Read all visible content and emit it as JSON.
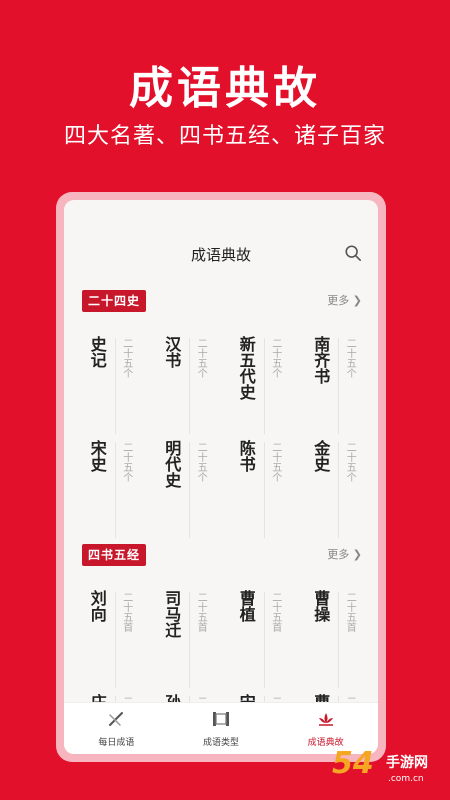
{
  "hero": {
    "title": "成语典故",
    "subtitle": "四大名著、四书五经、诸子百家"
  },
  "app": {
    "title": "成语典故",
    "search_icon": "search-icon"
  },
  "sections": [
    {
      "badge": "二十四史",
      "more": "更多 ❯",
      "items": [
        {
          "name": "史记",
          "count": "二十五个"
        },
        {
          "name": "汉书",
          "count": "二十五个"
        },
        {
          "name": "新五代史",
          "count": "二十五个"
        },
        {
          "name": "南齐书",
          "count": "二十五个"
        },
        {
          "name": "宋史",
          "count": "二十五个"
        },
        {
          "name": "明代史",
          "count": "二十五个"
        },
        {
          "name": "陈书",
          "count": "二十五个"
        },
        {
          "name": "金史",
          "count": "二十五个"
        }
      ]
    },
    {
      "badge": "四书五经",
      "more": "更多 ❯",
      "items": [
        {
          "name": "刘向",
          "count": "二十五首"
        },
        {
          "name": "司马迁",
          "count": "二十五首"
        },
        {
          "name": "曹植",
          "count": "二十五首"
        },
        {
          "name": "曹操",
          "count": "二十五首"
        },
        {
          "name": "庄",
          "count": "二"
        },
        {
          "name": "孙",
          "count": "二"
        },
        {
          "name": "宋",
          "count": "二"
        },
        {
          "name": "曹",
          "count": "二"
        }
      ]
    }
  ],
  "tabs": [
    {
      "label": "每日成语",
      "icon": "pen-brush-icon"
    },
    {
      "label": "成语类型",
      "icon": "scroll-icon"
    },
    {
      "label": "成语典故",
      "icon": "lotus-icon",
      "active": true
    }
  ],
  "watermark": {
    "number": "54",
    "text": "手游网",
    "domain": ".com.cn"
  },
  "colors": {
    "brand": "#e2102a",
    "badge": "#c8162b"
  }
}
